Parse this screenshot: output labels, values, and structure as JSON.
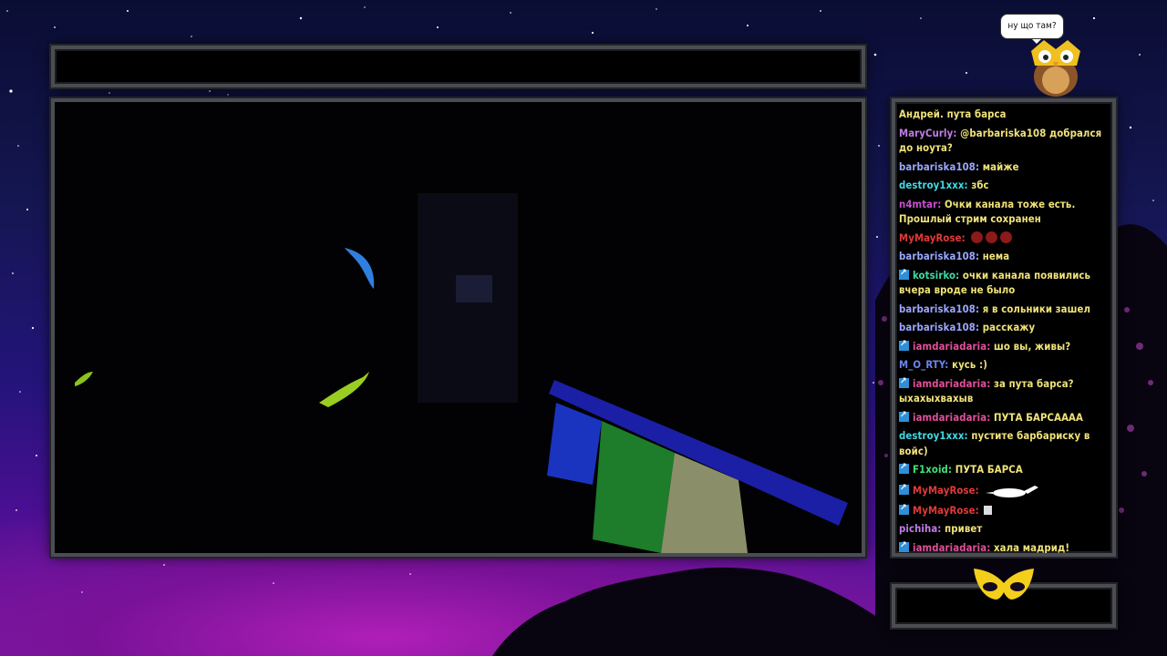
{
  "overlay": {
    "speech_bubble_text": "ну що там?",
    "owl_logo_icon": "owl-mascot-icon",
    "mask_icon": "owl-mask-icon"
  },
  "colors": {
    "frame_border": "#4a4d52",
    "panel_bg": "#000000",
    "chat_text": "#f0e37a"
  },
  "chat": {
    "messages": [
      {
        "user": "",
        "text": "Андрей. пута барса",
        "color": "#c7a4ff",
        "badge": false
      },
      {
        "user": "MaryCurly:",
        "text": "@barbariska108 добрался до ноута?",
        "color": "#c07de8",
        "badge": false
      },
      {
        "user": "barbariska108:",
        "text": "майже",
        "color": "#9aa6ff",
        "badge": false
      },
      {
        "user": "destroy1xxx:",
        "text": "збс",
        "color": "#3fd9e6",
        "badge": false
      },
      {
        "user": "n4mtar:",
        "text": "Очки канала тоже есть. Прошлый стрим сохранен",
        "color": "#c64fd0",
        "badge": false
      },
      {
        "user": "MyMayRose:",
        "text": "",
        "color": "#e03a3a",
        "badge": false,
        "emotes": 3
      },
      {
        "user": "barbariska108:",
        "text": "нема",
        "color": "#9aa6ff",
        "badge": false
      },
      {
        "user": "kotsirko:",
        "text": "очки канала появились вчера вроде не было",
        "color": "#3fd9a8",
        "badge": true
      },
      {
        "user": "barbariska108:",
        "text": "я в сольники зашел",
        "color": "#9aa6ff",
        "badge": false
      },
      {
        "user": "barbariska108:",
        "text": "расскажу",
        "color": "#9aa6ff",
        "badge": false
      },
      {
        "user": "iamdariadaria:",
        "text": "шо вы, живы?",
        "color": "#e0509a",
        "badge": true
      },
      {
        "user": "M_O_RTY:",
        "text": "кусь :)",
        "color": "#6c84f0",
        "badge": false
      },
      {
        "user": "iamdariadaria:",
        "text": "за пута барса? ыхахыхвахыв",
        "color": "#e0509a",
        "badge": true
      },
      {
        "user": "iamdariadaria:",
        "text": "ПУТА БАРСАААА",
        "color": "#e0509a",
        "badge": true
      },
      {
        "user": "destroy1xxx:",
        "text": "пустите барбариску в войс)",
        "color": "#3fd9e6",
        "badge": false
      },
      {
        "user": "F1xoid:",
        "text": "ПУТА БАРСА",
        "color": "#3fe07a",
        "badge": true
      },
      {
        "user": "MyMayRose:",
        "text": "",
        "color": "#e03a3a",
        "badge": true,
        "image": "goose-emote-icon"
      },
      {
        "user": "MyMayRose:",
        "text": "",
        "color": "#e03a3a",
        "badge": true,
        "image": "small-emote-icon"
      },
      {
        "user": "pichiha:",
        "text": "привет",
        "color": "#c07de8",
        "badge": false
      },
      {
        "user": "iamdariadaria:",
        "text": "хала мадрид!",
        "color": "#e0509a",
        "badge": true
      }
    ]
  }
}
